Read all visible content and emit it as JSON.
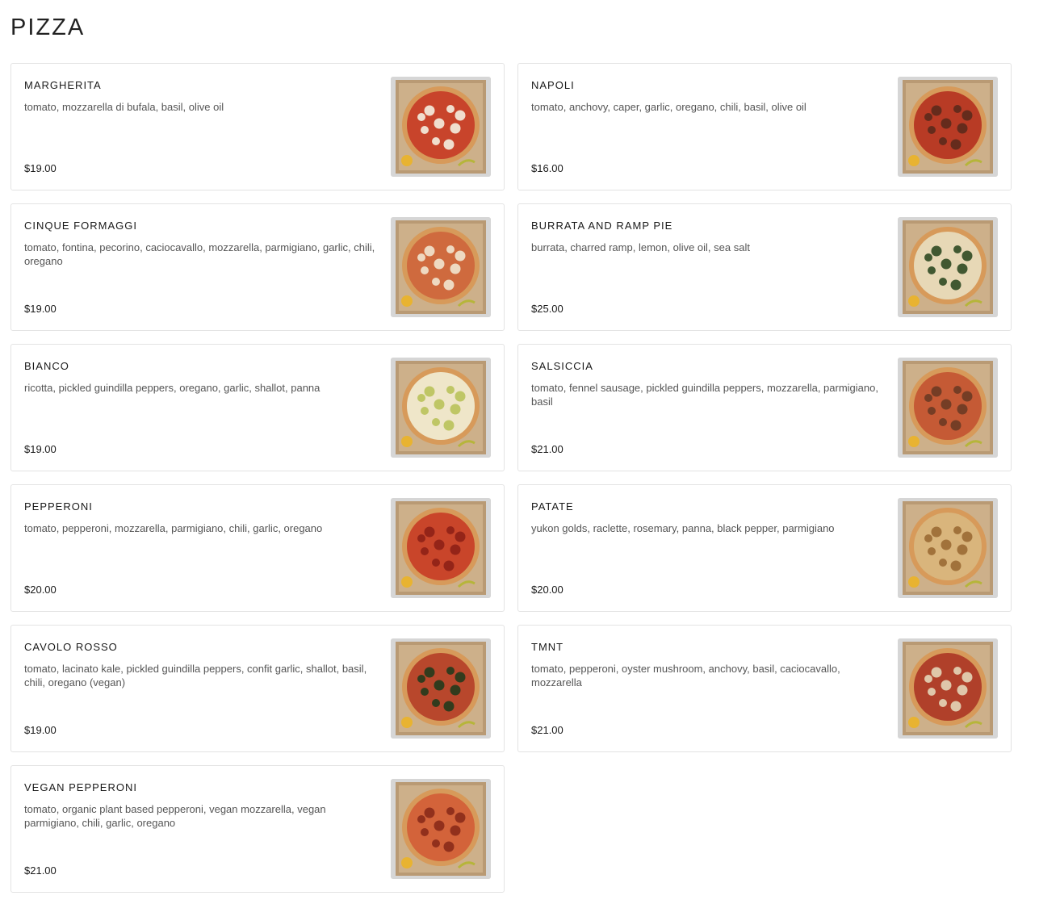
{
  "page": {
    "title": "PIZZA"
  },
  "items": [
    {
      "name": "MARGHERITA",
      "description": "tomato, mozzarella di bufala, basil, olive oil",
      "price": "$19.00",
      "image": "margherita-pizza-image",
      "pizza_color": "#c8442b",
      "topping_color": "#f4efe0"
    },
    {
      "name": "NAPOLI",
      "description": "tomato, anchovy, caper, garlic, oregano, chili, basil, olive oil",
      "price": "$16.00",
      "image": "napoli-pizza-image",
      "pizza_color": "#b83b25",
      "topping_color": "#5c2a1c"
    },
    {
      "name": "CINQUE FORMAGGI",
      "description": "tomato, fontina, pecorino, caciocavallo, mozzarella, parmigiano, garlic, chili, oregano",
      "price": "$19.00",
      "image": "cinque-formaggi-pizza-image",
      "pizza_color": "#cf6a3e",
      "topping_color": "#f1e6cf"
    },
    {
      "name": "BURRATA AND RAMP PIE",
      "description": "burrata, charred ramp, lemon, olive oil, sea salt",
      "price": "$25.00",
      "image": "burrata-ramp-pizza-image",
      "pizza_color": "#e7d8b6",
      "topping_color": "#2f4a22"
    },
    {
      "name": "BIANCO",
      "description": "ricotta, pickled guindilla peppers, oregano, garlic, shallot, panna",
      "price": "$19.00",
      "image": "bianco-pizza-image",
      "pizza_color": "#efe6c9",
      "topping_color": "#b9c25a"
    },
    {
      "name": "SALSICCIA",
      "description": "tomato, fennel sausage, pickled guindilla peppers, mozzarella, parmigiano, basil",
      "price": "$21.00",
      "image": "salsiccia-pizza-image",
      "pizza_color": "#c55a35",
      "topping_color": "#6b3a24"
    },
    {
      "name": "PEPPERONI",
      "description": "tomato, pepperoni, mozzarella, parmigiano, chili, garlic, oregano",
      "price": "$20.00",
      "image": "pepperoni-pizza-image",
      "pizza_color": "#c9452a",
      "topping_color": "#8e2016"
    },
    {
      "name": "PATATE",
      "description": "yukon golds, raclette, rosemary, panna, black pepper, parmigiano",
      "price": "$20.00",
      "image": "patate-pizza-image",
      "pizza_color": "#d9b57c",
      "topping_color": "#9a6a34"
    },
    {
      "name": "CAVOLO ROSSO",
      "description": "tomato, lacinato kale, pickled guindilla peppers, confit garlic, shallot, basil, chili, oregano (vegan)",
      "price": "$19.00",
      "image": "cavolo-rosso-pizza-image",
      "pizza_color": "#b8472c",
      "topping_color": "#233a1c"
    },
    {
      "name": "TMNT",
      "description": "tomato, pepperoni, oyster mushroom, anchovy, basil, caciocavallo, mozzarella",
      "price": "$21.00",
      "image": "tmnt-pizza-image",
      "pizza_color": "#b0402a",
      "topping_color": "#e4d6b8"
    },
    {
      "name": "VEGAN PEPPERONI",
      "description": "tomato, organic plant based pepperoni, vegan mozzarella, vegan parmigiano, chili, garlic, oregano",
      "price": "$21.00",
      "image": "vegan-pepperoni-pizza-image",
      "pizza_color": "#d3633a",
      "topping_color": "#8a2a1a"
    }
  ]
}
